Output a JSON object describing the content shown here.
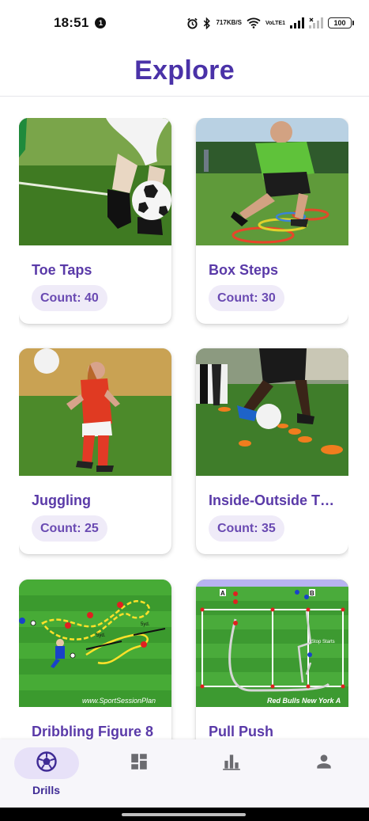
{
  "status_bar": {
    "time": "18:51",
    "notification_count": "1",
    "net_speed_value": "717",
    "net_speed_unit": "KB/S",
    "volte_top": "Vo",
    "volte_bottom": "LTE1",
    "battery": "100"
  },
  "header": {
    "title": "Explore"
  },
  "drills": [
    {
      "title": "Toe Taps",
      "count": "Count: 40",
      "image": "toe-taps-photo"
    },
    {
      "title": "Box Steps",
      "count": "Count: 30",
      "image": "box-steps-photo"
    },
    {
      "title": "Juggling",
      "count": "Count: 25",
      "image": "juggling-photo"
    },
    {
      "title": "Inside-Outside T…",
      "count": "Count: 35",
      "image": "inside-outside-photo"
    },
    {
      "title": "Dribbling Figure 8",
      "count": "",
      "image": "dribbling-figure-8-diagram"
    },
    {
      "title": "Pull Push",
      "count": "",
      "image": "pull-push-diagram"
    }
  ],
  "drill_diagrams": {
    "figure8_watermark": "www.SportSessionPlan",
    "figure8_marker_1": "5yd.",
    "figure8_marker_2": "5yd.",
    "pullpush_watermark": "Red Bulls New York A",
    "pullpush_corner_a": "A",
    "pullpush_corner_b": "B",
    "pullpush_note": "Stop Starts"
  },
  "bottom_nav": {
    "items": [
      {
        "label": "Drills",
        "icon": "soccer-ball-icon",
        "active": true
      },
      {
        "label": "",
        "icon": "dashboard-icon",
        "active": false
      },
      {
        "label": "",
        "icon": "bar-chart-icon",
        "active": false
      },
      {
        "label": "",
        "icon": "person-icon",
        "active": false
      }
    ]
  },
  "colors": {
    "accent": "#4a32a8",
    "title_purple": "#5a3aa8",
    "badge_bg": "#efebf8",
    "nav_active_bg": "#e7e1f8",
    "nav_icon": "#6b6b70"
  }
}
